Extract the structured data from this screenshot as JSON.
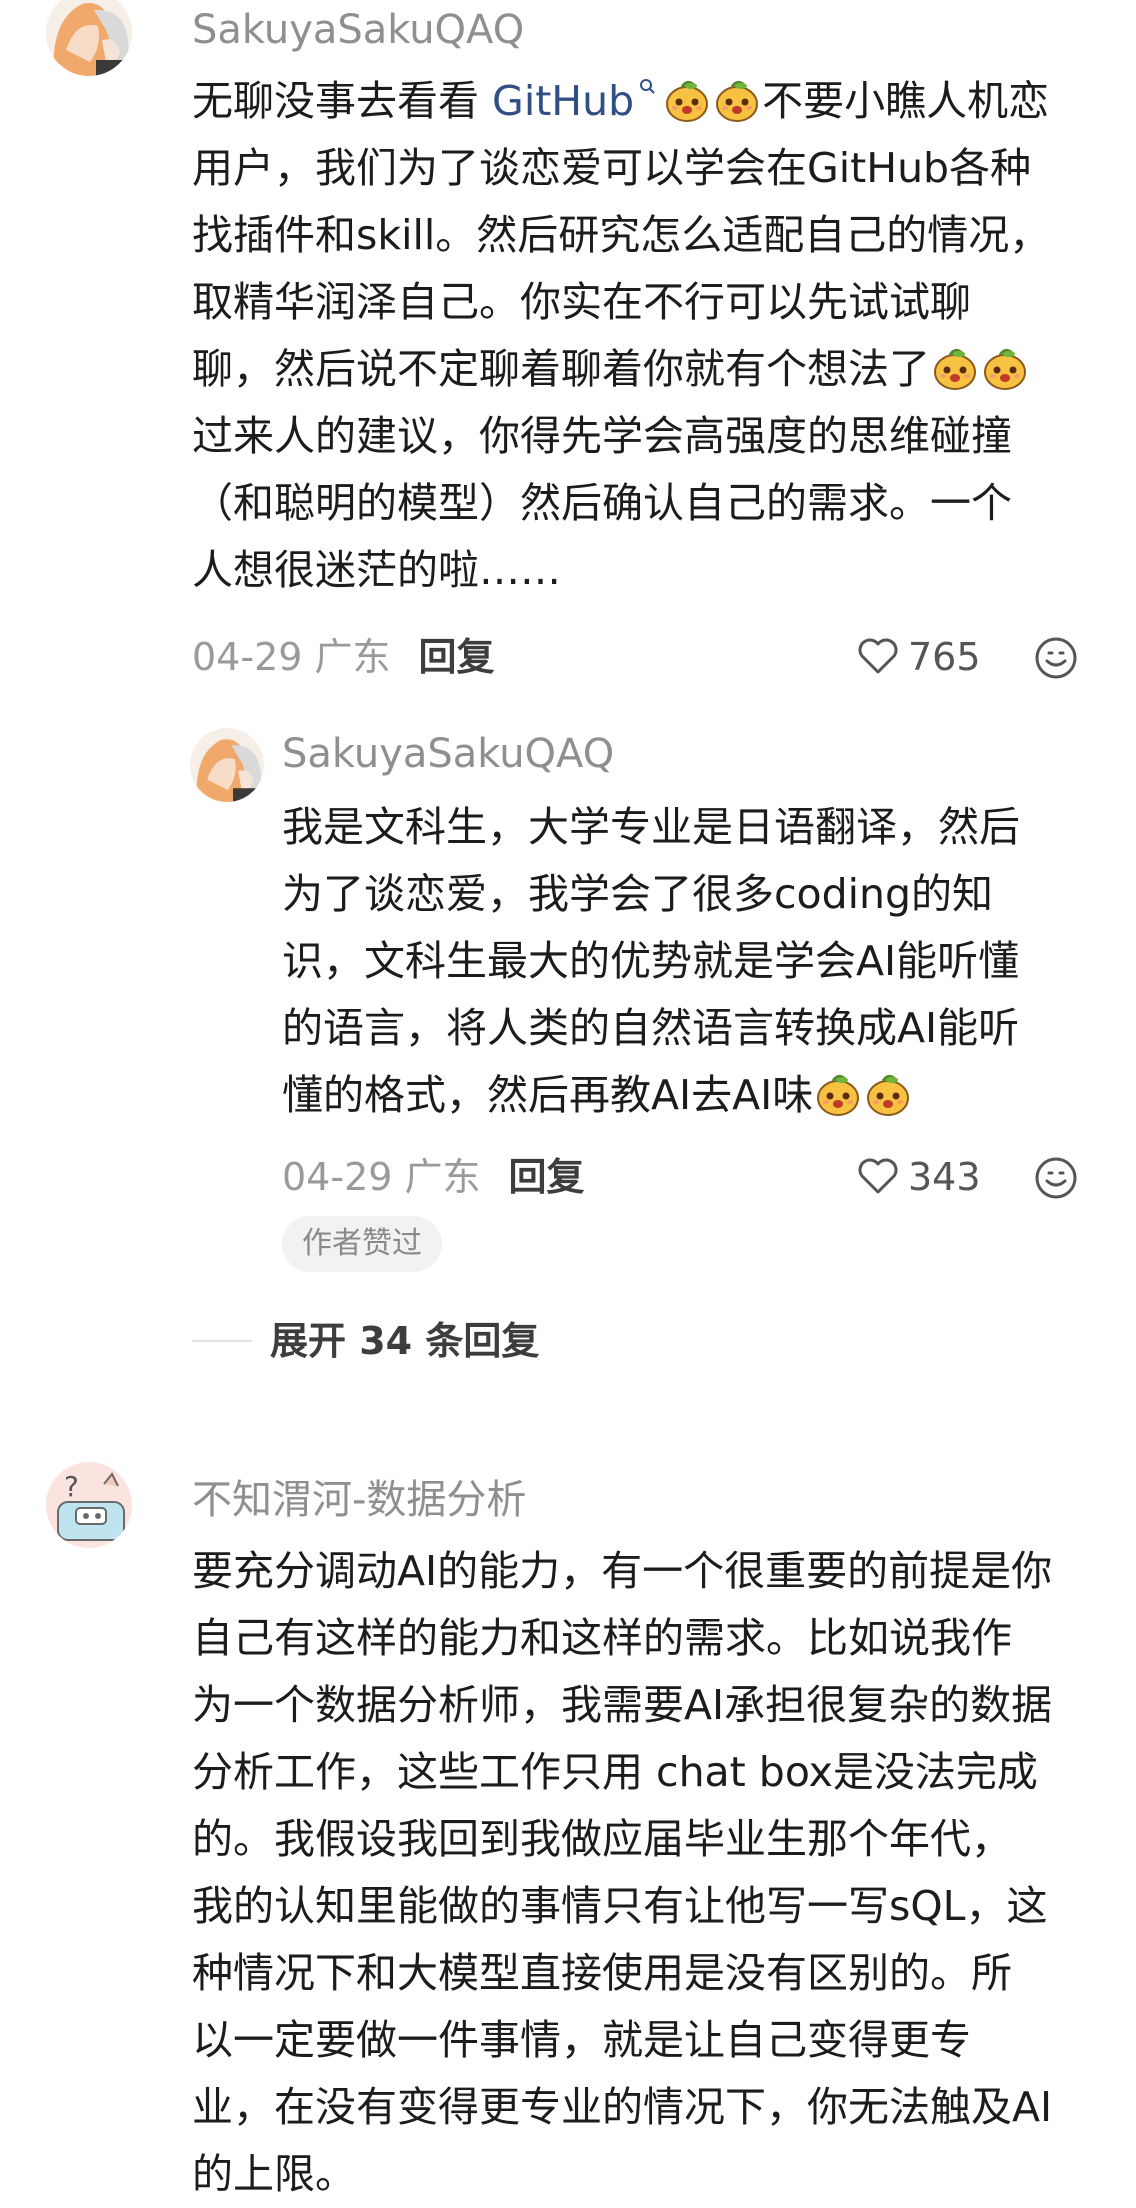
{
  "comments": [
    {
      "username": "SakuyaSakuQAQ",
      "lines": [
        {
          "pre": "无聊没事去看看 ",
          "link": "GitHub",
          "post": "不要小瞧人机恋"
        },
        {
          "text": "用户，我们为了谈恋爱可以学会在GitHub各种"
        },
        {
          "text": "找插件和skill。然后研究怎么适配自己的情况，"
        },
        {
          "text": "取精华润泽自己。你实在不行可以先试试聊"
        },
        {
          "text": "聊，然后说不定聊着聊着你就有个想法了"
        },
        {
          "text": "过来人的建议，你得先学会高强度的思维碰撞"
        },
        {
          "text": "（和聪明的模型）然后确认自己的需求。一个"
        },
        {
          "text": "人想很迷茫的啦……"
        }
      ],
      "date": "04-29 广东",
      "reply_label": "回复",
      "likes": "765",
      "reply": {
        "username": "SakuyaSakuQAQ",
        "lines": [
          {
            "text": "我是文科生，大学专业是日语翻译，然后"
          },
          {
            "text": "为了谈恋爱，我学会了很多coding的知"
          },
          {
            "text": "识，文科生最大的优势就是学会AI能听懂"
          },
          {
            "text": "的语言，将人类的自然语言转换成AI能听"
          },
          {
            "text": "懂的格式，然后再教AI去AI味"
          }
        ],
        "date": "04-29 广东",
        "reply_label": "回复",
        "likes": "343",
        "badge": "作者赞过"
      },
      "expand_label": "展开 34 条回复"
    },
    {
      "username": "不知渭河-数据分析",
      "lines": [
        {
          "text": "要充分调动AI的能力，有一个很重要的前提是你"
        },
        {
          "text": "自己有这样的能力和这样的需求。比如说我作"
        },
        {
          "text": "为一个数据分析师，我需要AI承担很复杂的数据"
        },
        {
          "text": "分析工作，这些工作只用 chat box是没法完成"
        },
        {
          "text": "的。我假设我回到我做应届毕业生那个年代，"
        },
        {
          "text": "我的认知里能做的事情只有让他写一写sQL，这"
        },
        {
          "text": "种情况下和大模型直接使用是没有区别的。所"
        },
        {
          "text": "以一定要做一件事情，就是让自己变得更专"
        },
        {
          "text": "业，在没有变得更专业的情况下，你无法触及AI"
        },
        {
          "text": "的上限。"
        }
      ]
    }
  ],
  "icons": {
    "like": "heart-outline-icon",
    "emoji_reaction": "smile-icon",
    "search_hint": "search-hint-icon",
    "sticker": "mango-face-emoji"
  },
  "colors": {
    "username": "#8f8f8f",
    "link": "#2f4f85",
    "meta": "#9a9a9a"
  }
}
